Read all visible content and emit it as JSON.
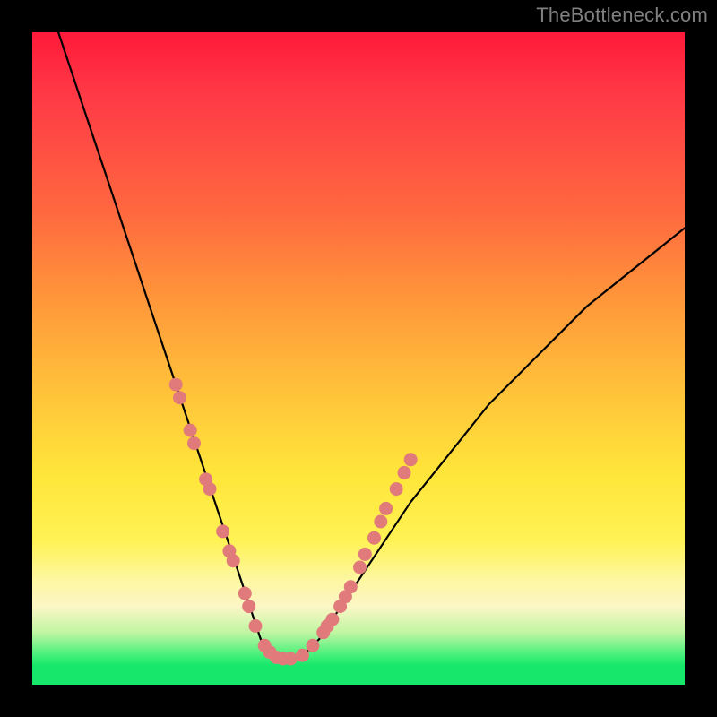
{
  "watermark": "TheBottleneck.com",
  "chart_data": {
    "type": "line",
    "title": "",
    "xlabel": "",
    "ylabel": "",
    "xlim": [
      0,
      100
    ],
    "ylim": [
      0,
      100
    ],
    "grid": false,
    "legend": false,
    "annotations": [],
    "series": [
      {
        "name": "bottleneck-curve",
        "x": [
          4,
          6,
          8,
          10,
          12,
          14,
          16,
          18,
          20,
          22,
          24,
          26,
          28,
          30,
          32,
          34,
          35,
          36,
          37,
          38,
          40,
          42,
          44,
          46,
          48,
          50,
          54,
          58,
          62,
          66,
          70,
          75,
          80,
          85,
          90,
          95,
          100
        ],
        "y": [
          100,
          94,
          88,
          82,
          76,
          70,
          64,
          58,
          52,
          46,
          40,
          34,
          28,
          22,
          16,
          10,
          7,
          5,
          4,
          4,
          4,
          5,
          7,
          10,
          13,
          16,
          22,
          28,
          33,
          38,
          43,
          48,
          53,
          58,
          62,
          66,
          70
        ]
      }
    ],
    "markers": {
      "name": "highlight-dots",
      "points": [
        {
          "x": 22.0,
          "y": 46.0
        },
        {
          "x": 22.6,
          "y": 44.0
        },
        {
          "x": 24.2,
          "y": 39.0
        },
        {
          "x": 24.8,
          "y": 37.0
        },
        {
          "x": 26.6,
          "y": 31.5
        },
        {
          "x": 27.2,
          "y": 30.0
        },
        {
          "x": 29.2,
          "y": 23.5
        },
        {
          "x": 30.2,
          "y": 20.5
        },
        {
          "x": 30.8,
          "y": 19.0
        },
        {
          "x": 32.6,
          "y": 14.0
        },
        {
          "x": 33.2,
          "y": 12.0
        },
        {
          "x": 34.2,
          "y": 9.0
        },
        {
          "x": 35.6,
          "y": 6.0
        },
        {
          "x": 36.4,
          "y": 5.0
        },
        {
          "x": 37.4,
          "y": 4.2
        },
        {
          "x": 38.4,
          "y": 4.0
        },
        {
          "x": 39.6,
          "y": 4.0
        },
        {
          "x": 41.4,
          "y": 4.5
        },
        {
          "x": 43.0,
          "y": 6.0
        },
        {
          "x": 44.6,
          "y": 8.0
        },
        {
          "x": 45.2,
          "y": 9.0
        },
        {
          "x": 46.0,
          "y": 10.0
        },
        {
          "x": 47.2,
          "y": 12.0
        },
        {
          "x": 48.0,
          "y": 13.5
        },
        {
          "x": 48.8,
          "y": 15.0
        },
        {
          "x": 50.2,
          "y": 18.0
        },
        {
          "x": 51.0,
          "y": 20.0
        },
        {
          "x": 52.4,
          "y": 22.5
        },
        {
          "x": 53.4,
          "y": 25.0
        },
        {
          "x": 54.2,
          "y": 27.0
        },
        {
          "x": 55.8,
          "y": 30.0
        },
        {
          "x": 57.0,
          "y": 32.5
        },
        {
          "x": 58.0,
          "y": 34.5
        }
      ]
    },
    "background_gradient": {
      "direction": "vertical",
      "stops": [
        {
          "pos": 0.0,
          "color": "#ff1a3a"
        },
        {
          "pos": 0.28,
          "color": "#ff6a3f"
        },
        {
          "pos": 0.55,
          "color": "#ffc23a"
        },
        {
          "pos": 0.78,
          "color": "#fff255"
        },
        {
          "pos": 0.88,
          "color": "#fcf6c6"
        },
        {
          "pos": 0.95,
          "color": "#45f07a"
        },
        {
          "pos": 1.0,
          "color": "#17e76b"
        }
      ]
    }
  }
}
